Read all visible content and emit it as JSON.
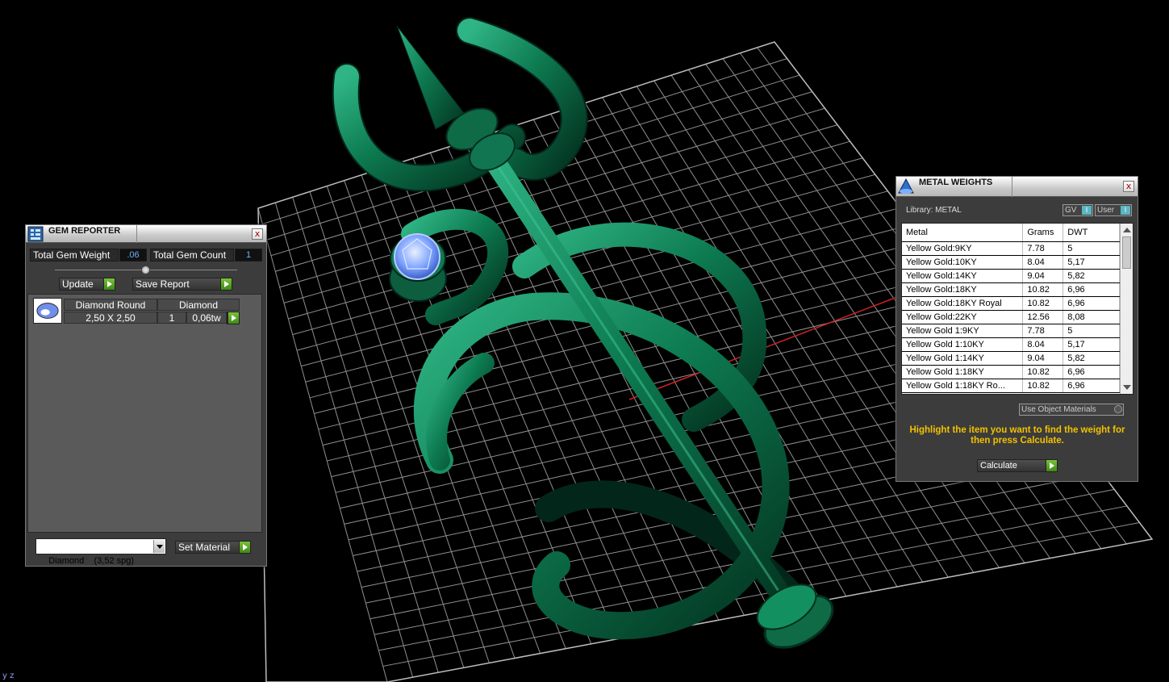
{
  "gem_reporter": {
    "title": "GEM REPORTER",
    "close": "x",
    "total_weight_label": "Total Gem Weight",
    "total_weight_value": ".06",
    "total_count_label": "Total Gem Count",
    "total_count_value": "1",
    "update_label": "Update",
    "save_report_label": "Save Report",
    "gem": {
      "shape": "Diamond Round",
      "material": "Diamond",
      "size": "2,50 X 2,50",
      "qty": "1",
      "weight": "0,06tw"
    },
    "material_select": "Diamond    (3,52 spg)",
    "set_material_label": "Set Material"
  },
  "metal_weights": {
    "title": "METAL WEIGHTS",
    "close": "x",
    "library_label": "Library: METAL",
    "toggle_gv": "GV",
    "toggle_user": "User",
    "toggle_indicator": "I",
    "columns": [
      "Metal",
      "Grams",
      "DWT"
    ],
    "rows": [
      [
        "Yellow Gold:9KY",
        "7.78",
        "5"
      ],
      [
        "Yellow Gold:10KY",
        "8.04",
        "5,17"
      ],
      [
        "Yellow Gold:14KY",
        "9.04",
        "5,82"
      ],
      [
        "Yellow Gold:18KY",
        "10.82",
        "6,96"
      ],
      [
        "Yellow Gold:18KY Royal",
        "10.82",
        "6,96"
      ],
      [
        "Yellow Gold:22KY",
        "12.56",
        "8,08"
      ],
      [
        "Yellow Gold 1:9KY",
        "7.78",
        "5"
      ],
      [
        "Yellow Gold 1:10KY",
        "8.04",
        "5,17"
      ],
      [
        "Yellow Gold 1:14KY",
        "9.04",
        "5,82"
      ],
      [
        "Yellow Gold 1:18KY",
        "10.82",
        "6,96"
      ],
      [
        "Yellow Gold 1:18KY Ro...",
        "10.82",
        "6,96"
      ]
    ],
    "use_object_materials": "Use Object Materials",
    "hint": "Highlight the item you want to find the weight for then press Calculate.",
    "calculate_label": "Calculate"
  },
  "viewport": {
    "axis_label": "y z",
    "model_color": "#0f7a52",
    "grid_color": "#9a9a9a",
    "axis_x_color": "#cc2222"
  }
}
